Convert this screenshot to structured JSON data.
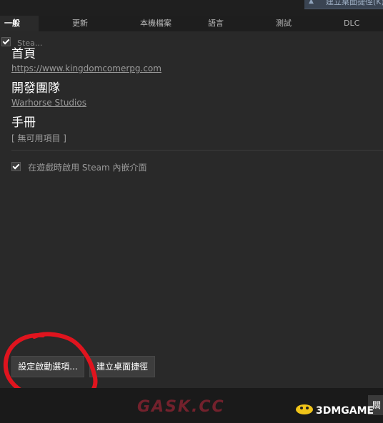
{
  "window": {
    "top_right_label": "建立桌面捷徑(K)"
  },
  "tabs": [
    {
      "label": "一般",
      "active": true
    },
    {
      "label": "更新",
      "active": false
    },
    {
      "label": "本機檔案",
      "active": false
    },
    {
      "label": "語言",
      "active": false
    },
    {
      "label": "測試",
      "active": false
    },
    {
      "label": "DLC",
      "active": false
    }
  ],
  "general": {
    "steam_checkbox_label": "Stea...",
    "steam_checkbox_checked": true,
    "homepage_heading": "首頁",
    "homepage_url": "https://www.kingdomcomerpg.com",
    "developer_heading": "開發團隊",
    "developer_name": "Warhorse Studios",
    "manual_heading": "手冊",
    "manual_value": "[ 無可用項目 ]",
    "overlay_checkbox_label": "在遊戲時啟用 Steam 內嵌介面",
    "overlay_checkbox_checked": true
  },
  "buttons": {
    "launch_options": "設定啟動選項...",
    "desktop_shortcut": "建立桌面捷徑",
    "close": "關閉"
  },
  "annotation": {
    "circle_color": "#e0141e"
  },
  "watermarks": {
    "center_text": "GASK.CC",
    "right_text": "3DMGAME"
  }
}
